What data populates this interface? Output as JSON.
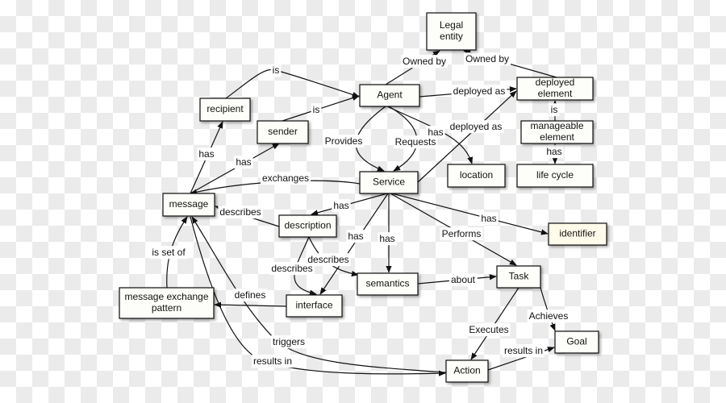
{
  "diagram": {
    "nodes": {
      "legal_entity": "Legal\nentity",
      "agent": "Agent",
      "deployed_element": "deployed\nelement",
      "manageable_element": "manageable\nelement",
      "life_cycle": "life cycle",
      "location": "location",
      "recipient": "recipient",
      "sender": "sender",
      "service": "Service",
      "message": "message",
      "description": "description",
      "identifier": "identifier",
      "semantics": "semantics",
      "task": "Task",
      "message_exchange_pattern": "message exchange\npattern",
      "interface": "interface",
      "goal": "Goal",
      "action": "Action"
    },
    "edges": [
      {
        "from": "agent",
        "to": "legal_entity",
        "label": "Owned by"
      },
      {
        "from": "deployed_element",
        "to": "legal_entity",
        "label": "Owned by"
      },
      {
        "from": "recipient",
        "to": "agent",
        "label": "is"
      },
      {
        "from": "sender",
        "to": "agent",
        "label": "is"
      },
      {
        "from": "agent",
        "to": "deployed_element",
        "label": "deployed as"
      },
      {
        "from": "service",
        "to": "deployed_element",
        "label": "deployed as"
      },
      {
        "from": "manageable_element",
        "to": "deployed_element",
        "label": "is"
      },
      {
        "from": "manageable_element",
        "to": "life_cycle",
        "label": "has"
      },
      {
        "from": "agent",
        "to": "location",
        "label": "has"
      },
      {
        "from": "agent",
        "to": "service",
        "label": "Provides"
      },
      {
        "from": "agent",
        "to": "service",
        "label": "Requests"
      },
      {
        "from": "message",
        "to": "recipient",
        "label": "has"
      },
      {
        "from": "message",
        "to": "sender",
        "label": "has"
      },
      {
        "from": "service",
        "to": "message",
        "label": "exchanges"
      },
      {
        "from": "description",
        "to": "message",
        "label": "describes"
      },
      {
        "from": "service",
        "to": "description",
        "label": "has"
      },
      {
        "from": "service",
        "to": "interface",
        "label": "has"
      },
      {
        "from": "service",
        "to": "semantics",
        "label": "has"
      },
      {
        "from": "service",
        "to": "identifier",
        "label": "has"
      },
      {
        "from": "service",
        "to": "task",
        "label": "Performs"
      },
      {
        "from": "description",
        "to": "interface",
        "label": "describes"
      },
      {
        "from": "description",
        "to": "semantics",
        "label": "describes"
      },
      {
        "from": "semantics",
        "to": "task",
        "label": "about"
      },
      {
        "from": "interface",
        "to": "message_exchange_pattern",
        "label": "defines"
      },
      {
        "from": "message_exchange_pattern",
        "to": "message",
        "label": "is set of"
      },
      {
        "from": "task",
        "to": "action",
        "label": "Executes"
      },
      {
        "from": "task",
        "to": "goal",
        "label": "Achieves"
      },
      {
        "from": "action",
        "to": "goal",
        "label": "results in"
      },
      {
        "from": "action",
        "to": "message",
        "label": "triggers"
      },
      {
        "from": "message",
        "to": "action",
        "label": "results in"
      }
    ],
    "colors": {
      "node_fill": "#fdfdf9",
      "highlight_fill": "#fffbea",
      "stroke": "#111111"
    }
  }
}
